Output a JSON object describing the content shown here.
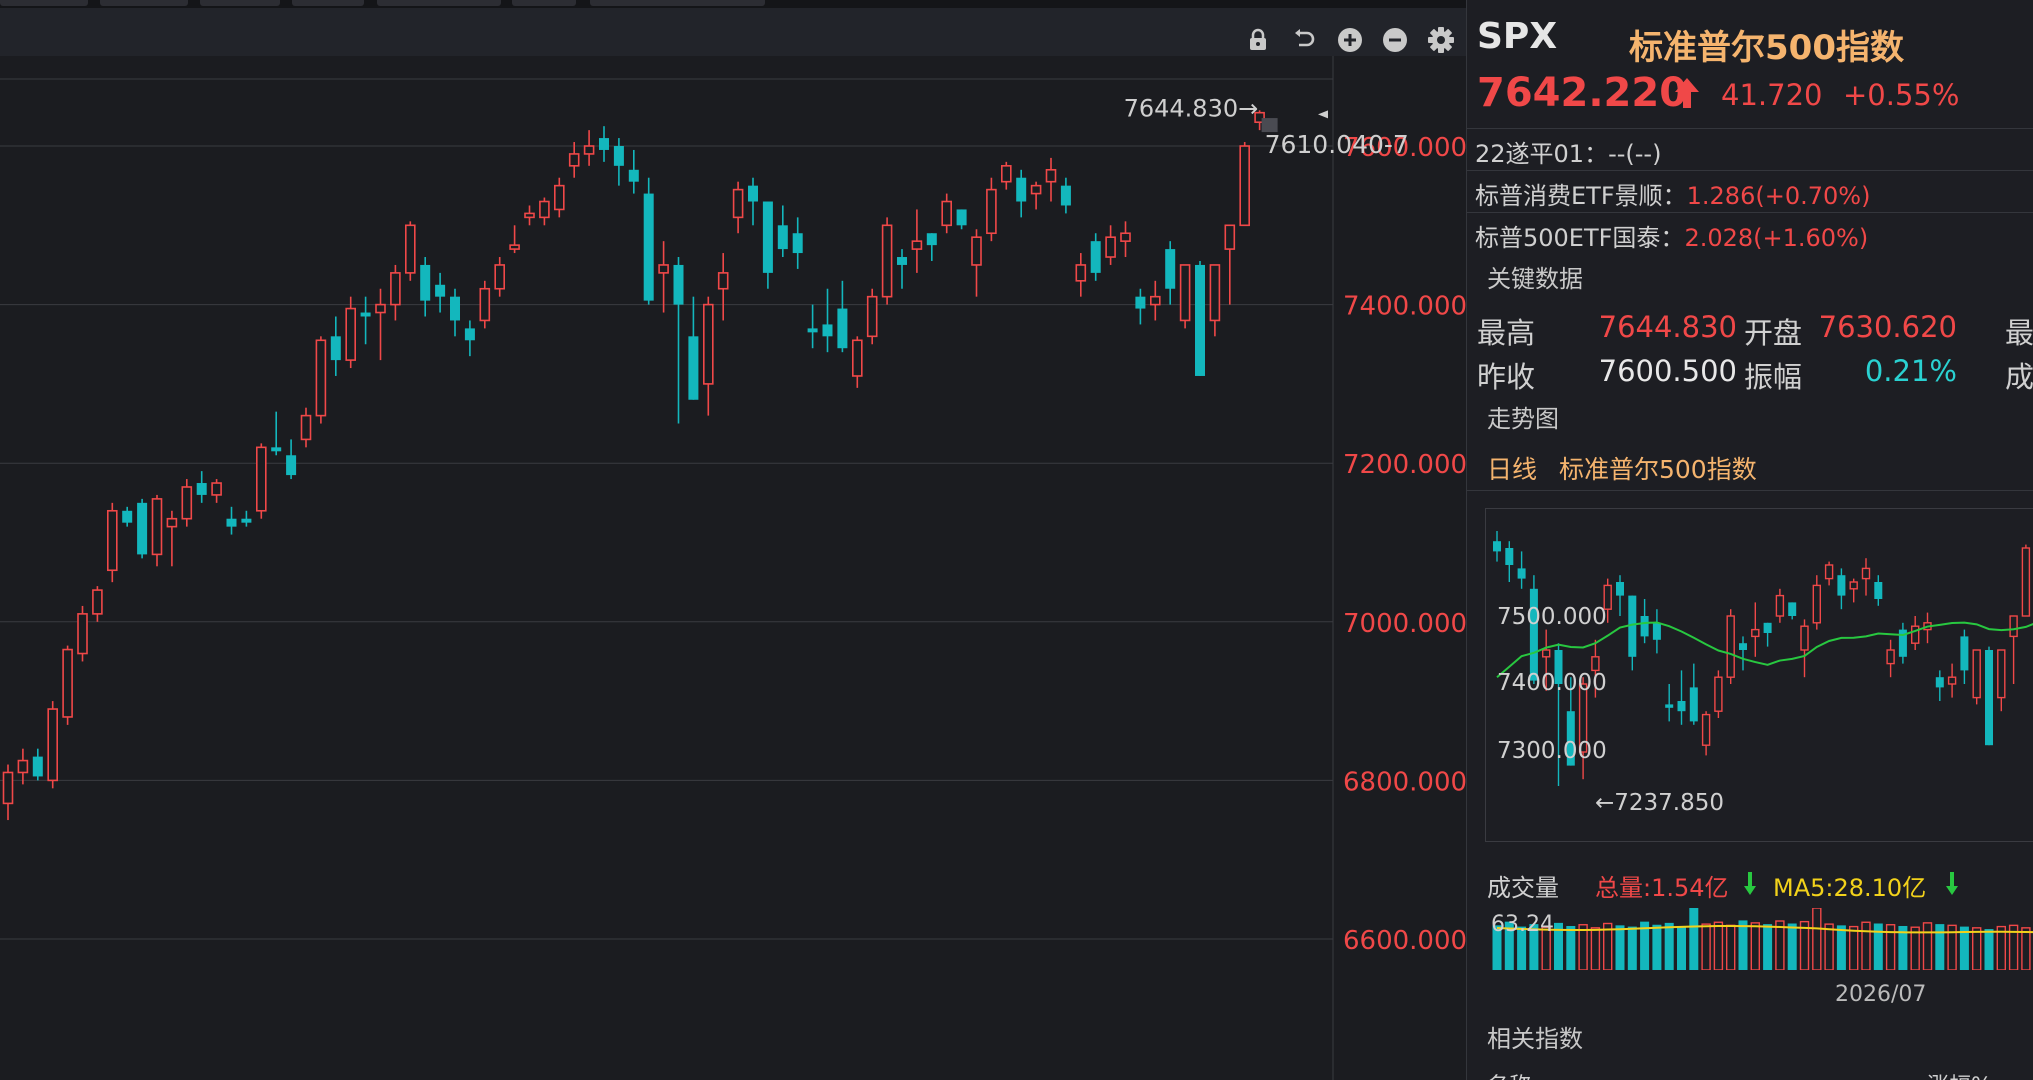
{
  "toolbar": {
    "icons": [
      "lock-icon",
      "undo-icon",
      "zoom-in-icon",
      "zoom-out-icon",
      "gear-icon"
    ]
  },
  "colors": {
    "up": "#f04848",
    "down": "#13b7bd",
    "grid": "#3a3b41",
    "axis_label": "#f04848",
    "ma_line": "#28c840",
    "vol_ma": "#f2d21b"
  },
  "main_chart": {
    "high_marker": "7644.830→",
    "last_marker": "7610.040-7",
    "y_labels": [
      "7600.000",
      "7400.000",
      "7200.000",
      "7000.000",
      "6800.000",
      "6600.000"
    ]
  },
  "quote": {
    "symbol": "SPX",
    "name": "标准普尔500指数",
    "price": "7642.220",
    "change": "41.720",
    "change_pct": "+0.55%"
  },
  "related_quotes": [
    {
      "label": "22遂平01：",
      "value": "--(--)"
    },
    {
      "label": "标普消费ETF景顺：",
      "value": "1.286(+0.70%)"
    },
    {
      "label": "标普500ETF国泰：",
      "value": "2.028(+1.60%)"
    }
  ],
  "key_data": {
    "title": "关键数据",
    "rows": [
      {
        "l1": "最高",
        "v1": "7644.830",
        "l2": "开盘",
        "v2": "7630.620",
        "l3": "最"
      },
      {
        "l1": "昨收",
        "v1": "7600.500",
        "l2": "振幅",
        "v2": "0.21%",
        "l3": "成"
      }
    ]
  },
  "trend": {
    "title": "走势图",
    "period": "日线",
    "name": "标准普尔500指数",
    "y_labels": [
      "7500.000",
      "7400.000",
      "7300.000"
    ],
    "low_marker": "←7237.850"
  },
  "volume": {
    "label": "成交量",
    "total": "总量:1.54亿",
    "ma5": "MA5:28.10亿",
    "max_label": "63.24",
    "date_label": "2026/07"
  },
  "related_index": {
    "title": "相关指数",
    "col1": "名称",
    "col2": "涨幅%"
  },
  "chart_data": {
    "type": "candlestick",
    "ylim": [
      6500,
      7700
    ],
    "candles": [
      [
        6771,
        6820,
        6750,
        6810
      ],
      [
        6810,
        6840,
        6795,
        6825
      ],
      [
        6830,
        6840,
        6800,
        6805
      ],
      [
        6800,
        6900,
        6790,
        6890
      ],
      [
        6880,
        6970,
        6870,
        6965
      ],
      [
        6960,
        7020,
        6950,
        7010
      ],
      [
        7010,
        7045,
        7000,
        7040
      ],
      [
        7065,
        7150,
        7050,
        7140
      ],
      [
        7140,
        7145,
        7120,
        7125
      ],
      [
        7150,
        7155,
        7080,
        7085
      ],
      [
        7085,
        7160,
        7070,
        7155
      ],
      [
        7120,
        7140,
        7070,
        7130
      ],
      [
        7130,
        7180,
        7120,
        7170
      ],
      [
        7175,
        7190,
        7150,
        7160
      ],
      [
        7160,
        7180,
        7150,
        7175
      ],
      [
        7130,
        7145,
        7110,
        7120
      ],
      [
        7130,
        7140,
        7120,
        7125
      ],
      [
        7140,
        7225,
        7130,
        7220
      ],
      [
        7220,
        7265,
        7210,
        7215
      ],
      [
        7210,
        7230,
        7180,
        7185
      ],
      [
        7230,
        7270,
        7220,
        7260
      ],
      [
        7260,
        7360,
        7250,
        7355
      ],
      [
        7360,
        7385,
        7310,
        7330
      ],
      [
        7330,
        7410,
        7320,
        7395
      ],
      [
        7390,
        7410,
        7350,
        7385
      ],
      [
        7390,
        7420,
        7330,
        7400
      ],
      [
        7400,
        7450,
        7380,
        7440
      ],
      [
        7440,
        7505,
        7430,
        7500
      ],
      [
        7450,
        7460,
        7385,
        7405
      ],
      [
        7425,
        7440,
        7390,
        7410
      ],
      [
        7410,
        7420,
        7360,
        7380
      ],
      [
        7370,
        7380,
        7335,
        7355
      ],
      [
        7380,
        7430,
        7370,
        7420
      ],
      [
        7420,
        7460,
        7410,
        7450
      ],
      [
        7470,
        7500,
        7465,
        7475
      ],
      [
        7510,
        7525,
        7500,
        7515
      ],
      [
        7510,
        7535,
        7500,
        7530
      ],
      [
        7520,
        7560,
        7510,
        7550
      ],
      [
        7575,
        7605,
        7560,
        7590
      ],
      [
        7590,
        7620,
        7575,
        7600
      ],
      [
        7610,
        7625,
        7580,
        7595
      ],
      [
        7600,
        7610,
        7550,
        7575
      ],
      [
        7570,
        7595,
        7540,
        7555
      ],
      [
        7540,
        7560,
        7400,
        7405
      ],
      [
        7440,
        7480,
        7390,
        7450
      ],
      [
        7450,
        7460,
        7250,
        7400
      ],
      [
        7360,
        7410,
        7280,
        7280
      ],
      [
        7300,
        7410,
        7260,
        7400
      ],
      [
        7420,
        7465,
        7380,
        7440
      ],
      [
        7510,
        7555,
        7490,
        7545
      ],
      [
        7550,
        7560,
        7500,
        7530
      ],
      [
        7530,
        7530,
        7420,
        7440
      ],
      [
        7500,
        7525,
        7460,
        7470
      ],
      [
        7490,
        7510,
        7445,
        7465
      ],
      [
        7370,
        7400,
        7345,
        7365
      ],
      [
        7375,
        7420,
        7340,
        7360
      ],
      [
        7395,
        7430,
        7340,
        7345
      ],
      [
        7310,
        7360,
        7295,
        7355
      ],
      [
        7360,
        7420,
        7350,
        7410
      ],
      [
        7410,
        7510,
        7400,
        7500
      ],
      [
        7460,
        7470,
        7420,
        7450
      ],
      [
        7470,
        7520,
        7440,
        7480
      ],
      [
        7490,
        7490,
        7455,
        7475
      ],
      [
        7500,
        7540,
        7490,
        7530
      ],
      [
        7520,
        7520,
        7495,
        7500
      ],
      [
        7450,
        7495,
        7410,
        7485
      ],
      [
        7490,
        7560,
        7480,
        7545
      ],
      [
        7555,
        7580,
        7545,
        7575
      ],
      [
        7560,
        7570,
        7510,
        7530
      ],
      [
        7540,
        7555,
        7520,
        7550
      ],
      [
        7555,
        7585,
        7530,
        7570
      ],
      [
        7550,
        7560,
        7515,
        7525
      ],
      [
        7430,
        7465,
        7410,
        7450
      ],
      [
        7480,
        7490,
        7430,
        7440
      ],
      [
        7460,
        7500,
        7450,
        7485
      ],
      [
        7480,
        7505,
        7460,
        7490
      ],
      [
        7410,
        7420,
        7375,
        7395
      ],
      [
        7400,
        7430,
        7380,
        7410
      ],
      [
        7470,
        7480,
        7400,
        7420
      ],
      [
        7380,
        7450,
        7370,
        7450
      ],
      [
        7450,
        7455,
        7310,
        7310
      ],
      [
        7380,
        7450,
        7360,
        7450
      ],
      [
        7470,
        7500,
        7400,
        7500
      ],
      [
        7500,
        7605,
        7500,
        7600
      ],
      [
        7630,
        7645,
        7620,
        7642
      ]
    ]
  }
}
